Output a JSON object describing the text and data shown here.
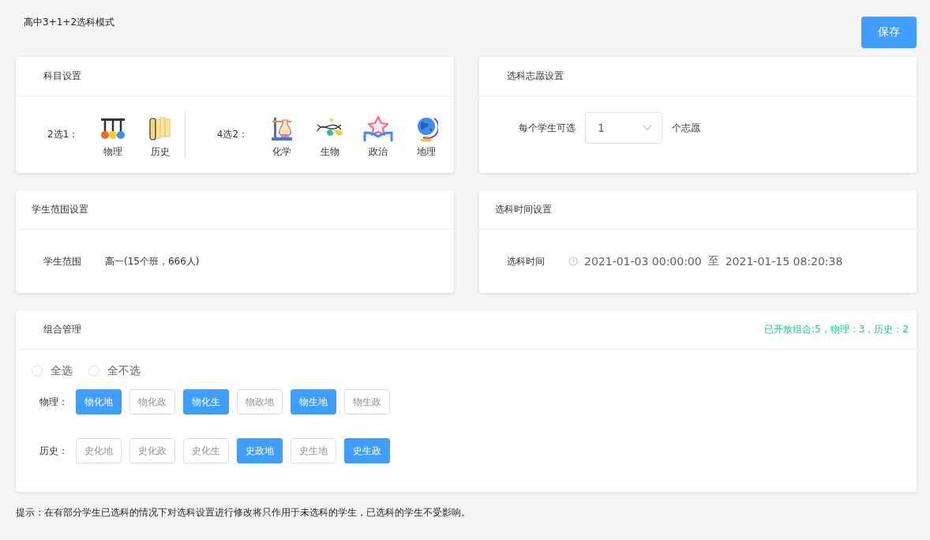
{
  "page_title": "高中3+1+2选科模式",
  "save_button": "保存",
  "subject_card": {
    "title": "科目设置",
    "groups": [
      {
        "label": "2选1：",
        "subjects": [
          "物理",
          "历史"
        ]
      },
      {
        "label": "4选2：",
        "subjects": [
          "化学",
          "生物",
          "政治",
          "地理"
        ]
      }
    ]
  },
  "wish_card": {
    "title": "选科志愿设置",
    "prefix": "每个学生可选",
    "value": "1",
    "suffix": "个志愿"
  },
  "range_card": {
    "title": "学生范围设置",
    "label": "学生范围",
    "value": "高一(15个班，666人)"
  },
  "time_card": {
    "title": "选科时间设置",
    "label": "选科时间",
    "start": "2021-01-03 00:00:00",
    "separator": "至",
    "end": "2021-01-15 08:20:38"
  },
  "combo_card": {
    "title": "组合管理",
    "summary": "已开放组合:5，物理：3，历史：2",
    "options": [
      {
        "label": "全选",
        "selected": false
      },
      {
        "label": "全不选",
        "selected": false
      }
    ],
    "rows": [
      {
        "label": "物理：",
        "combos": [
          {
            "label": "物化地",
            "selected": true
          },
          {
            "label": "物化政",
            "selected": false
          },
          {
            "label": "物化生",
            "selected": true
          },
          {
            "label": "物政地",
            "selected": false
          },
          {
            "label": "物生地",
            "selected": true
          },
          {
            "label": "物生政",
            "selected": false
          }
        ]
      },
      {
        "label": "历史：",
        "combos": [
          {
            "label": "史化地",
            "selected": false
          },
          {
            "label": "史化政",
            "selected": false
          },
          {
            "label": "史化生",
            "selected": false
          },
          {
            "label": "史政地",
            "selected": true
          },
          {
            "label": "史生地",
            "selected": false
          },
          {
            "label": "史生政",
            "selected": true
          }
        ]
      }
    ]
  },
  "hint": "提示：在有部分学生已选科的情况下对选科设置进行修改将只作用于未选科的学生，已选科的学生不受影响。"
}
